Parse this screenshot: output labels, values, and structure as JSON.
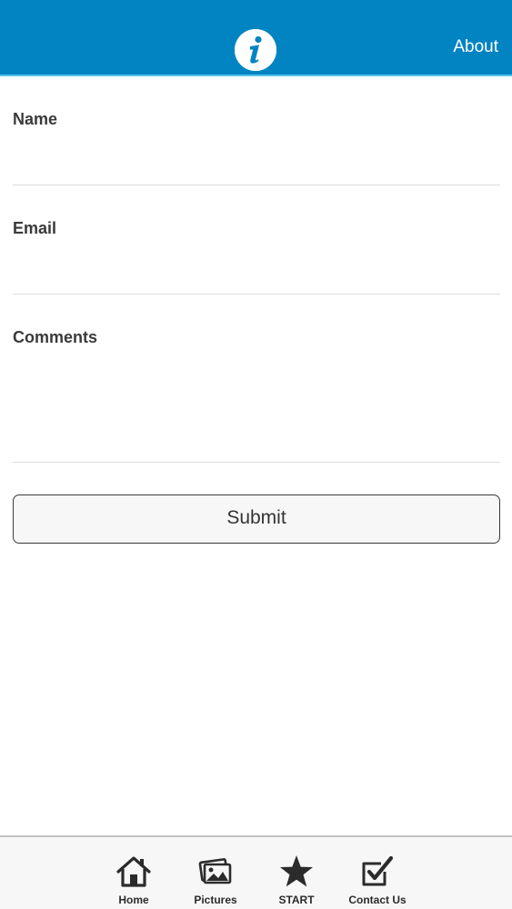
{
  "header": {
    "logo_icon": "info-icon",
    "about_label": "About",
    "background_color": "#0284c2",
    "accent_line_color": "#56c5ea"
  },
  "form": {
    "name_label": "Name",
    "name_value": "",
    "email_label": "Email",
    "email_value": "",
    "comments_label": "Comments",
    "comments_value": "",
    "submit_label": "Submit"
  },
  "tabbar": {
    "items": [
      {
        "label": "Home",
        "icon": "home-icon"
      },
      {
        "label": "Pictures",
        "icon": "pictures-icon"
      },
      {
        "label": "START",
        "icon": "star-icon"
      },
      {
        "label": "Contact Us",
        "icon": "contact-check-icon"
      }
    ]
  }
}
